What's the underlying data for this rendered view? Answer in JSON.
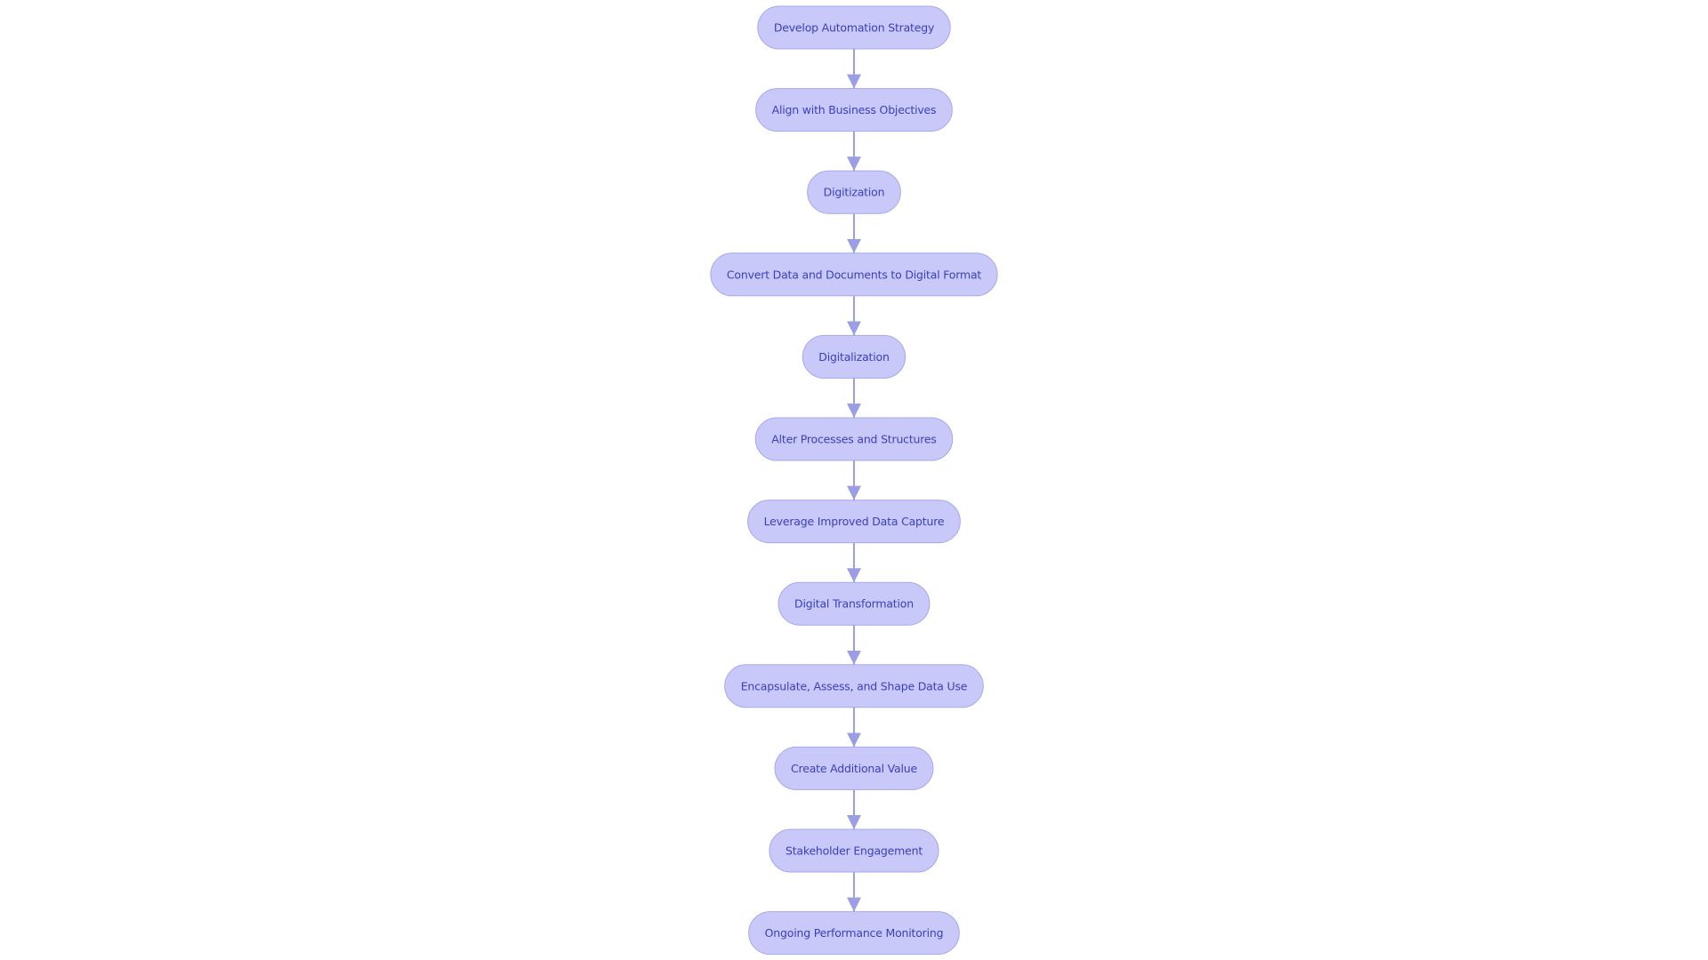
{
  "diagram": {
    "type": "flowchart",
    "direction": "top-to-bottom",
    "colors": {
      "node_fill": "#c8c9f9",
      "node_stroke": "#a6a8ec",
      "node_text": "#3a3fbf",
      "edge": "#9b9ee6",
      "background": "#ffffff"
    },
    "nodes": [
      {
        "id": "n1",
        "label": "Develop Automation Strategy"
      },
      {
        "id": "n2",
        "label": "Align with Business Objectives"
      },
      {
        "id": "n3",
        "label": "Digitization"
      },
      {
        "id": "n4",
        "label": "Convert Data and Documents to Digital Format"
      },
      {
        "id": "n5",
        "label": "Digitalization"
      },
      {
        "id": "n6",
        "label": "Alter Processes and Structures"
      },
      {
        "id": "n7",
        "label": "Leverage Improved Data Capture"
      },
      {
        "id": "n8",
        "label": "Digital Transformation"
      },
      {
        "id": "n9",
        "label": "Encapsulate, Assess, and Shape Data Use"
      },
      {
        "id": "n10",
        "label": "Create Additional Value"
      },
      {
        "id": "n11",
        "label": "Stakeholder Engagement"
      },
      {
        "id": "n12",
        "label": "Ongoing Performance Monitoring"
      }
    ],
    "edges": [
      {
        "from": "n1",
        "to": "n2"
      },
      {
        "from": "n2",
        "to": "n3"
      },
      {
        "from": "n3",
        "to": "n4"
      },
      {
        "from": "n4",
        "to": "n5"
      },
      {
        "from": "n5",
        "to": "n6"
      },
      {
        "from": "n6",
        "to": "n7"
      },
      {
        "from": "n7",
        "to": "n8"
      },
      {
        "from": "n8",
        "to": "n9"
      },
      {
        "from": "n9",
        "to": "n10"
      },
      {
        "from": "n10",
        "to": "n11"
      },
      {
        "from": "n11",
        "to": "n12"
      }
    ]
  }
}
